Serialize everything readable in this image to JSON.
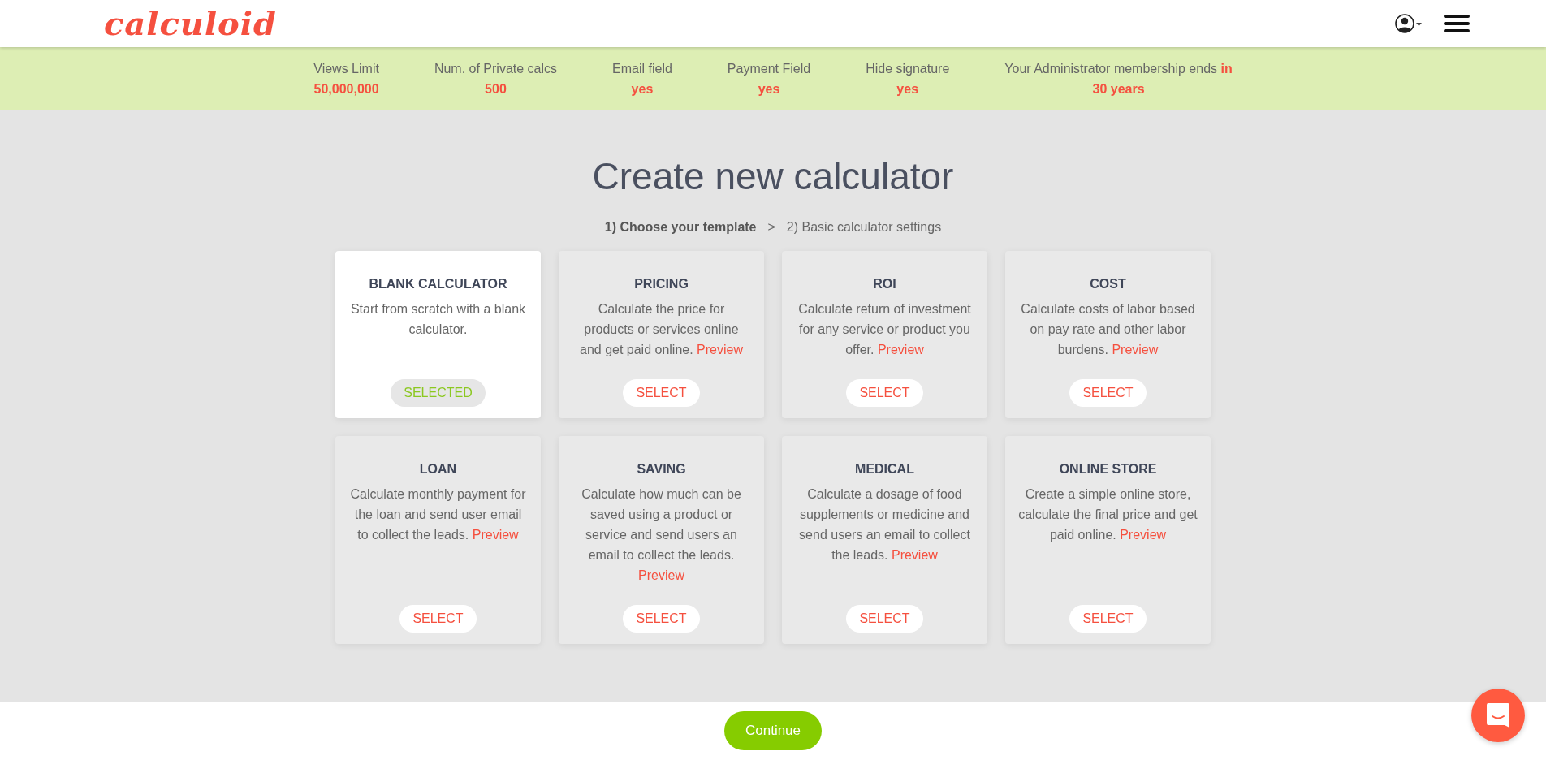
{
  "header": {
    "logo": "calculoid"
  },
  "limits": [
    {
      "label": "Views Limit",
      "value": "50,000,000"
    },
    {
      "label": "Num. of Private calcs",
      "value": "500"
    },
    {
      "label": "Email field",
      "value": "yes"
    },
    {
      "label": "Payment Field",
      "value": "yes"
    },
    {
      "label": "Hide signature",
      "value": "yes"
    },
    {
      "label": "Your Administrator membership ends",
      "label_accent": "in",
      "value": "30 years"
    }
  ],
  "title": "Create new calculator",
  "steps": [
    {
      "label": "1) Choose your template",
      "selected": true
    },
    {
      "label": "2) Basic calculator settings",
      "selected": false
    }
  ],
  "step_separator": ">",
  "templates": [
    {
      "name": "BLANK CALCULATOR",
      "description": "Start from scratch with a blank calculator.",
      "button": "SELECTED",
      "selected": true
    },
    {
      "name": "PRICING",
      "description": "Calculate the price for products or services online and get paid online.",
      "preview": "Preview",
      "button": "SELECT",
      "selected": false
    },
    {
      "name": "ROI",
      "description": "Calculate return of investment for any service or product you offer.",
      "preview": "Preview",
      "button": "SELECT",
      "selected": false
    },
    {
      "name": "COST",
      "description": "Calculate costs of labor based on pay rate and other labor burdens.",
      "preview": "Preview",
      "button": "SELECT",
      "selected": false
    },
    {
      "name": "LOAN",
      "description": "Calculate monthly payment for the loan and send user email to collect the leads.",
      "preview": "Preview",
      "button": "SELECT",
      "selected": false
    },
    {
      "name": "SAVING",
      "description": "Calculate how much can be saved using a product or service and send users an email to collect the leads.",
      "preview": "Preview",
      "button": "SELECT",
      "selected": false
    },
    {
      "name": "MEDICAL",
      "description": "Calculate a dosage of food supplements or medicine and send users an email to collect the leads.",
      "preview": "Preview",
      "button": "SELECT",
      "selected": false
    },
    {
      "name": "ONLINE STORE",
      "description": "Create a simple online store, calculate the final price and get paid online.",
      "preview": "Preview",
      "button": "SELECT",
      "selected": false
    }
  ],
  "footer": {
    "button": "Continue"
  }
}
